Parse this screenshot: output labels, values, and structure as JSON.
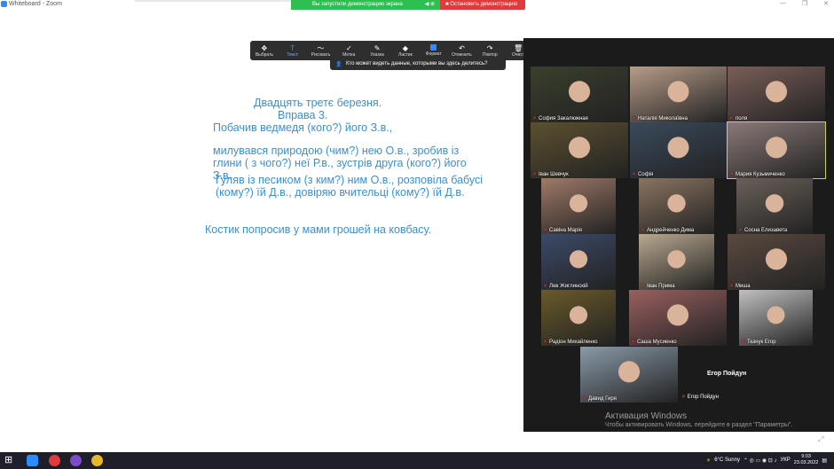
{
  "window": {
    "title": "Whiteboard - Zoom"
  },
  "share_banner": {
    "status": "Вы запустили демонстрацию экрана",
    "stop_label": "Остановить демонстрацию"
  },
  "toolbar": {
    "tools": [
      {
        "icon": "move-icon",
        "label": "Выбрать"
      },
      {
        "icon": "text-icon",
        "label": "Текст",
        "active": true
      },
      {
        "icon": "draw-icon",
        "label": "Рисовать"
      },
      {
        "icon": "stamp-icon",
        "label": "Метка"
      },
      {
        "icon": "spotlight-icon",
        "label": "Указка"
      },
      {
        "icon": "eraser-icon",
        "label": "Ластик"
      },
      {
        "icon": "format-icon",
        "label": "Формат"
      },
      {
        "icon": "undo-icon",
        "label": "Отменить"
      },
      {
        "icon": "redo-icon",
        "label": "Повтор"
      },
      {
        "icon": "clear-icon",
        "label": "Очист"
      }
    ],
    "privacy_prompt": "Кто может видеть данные, которыми вы здесь делитесь?"
  },
  "whiteboard": {
    "lines": [
      "Двадцять третє березня.",
      "Вправа 3.",
      "Побачив ведмедя (кого?) його З.в.,",
      "милувався природою (чим?)  нею  О.в., зробив із",
      "глини ( з чого?)  неї  Р.в.,  зустрів друга  (кого?) його",
      "З.в.",
      "Гуляв із песиком  (з ким?) ним О.в., розповіла бабусі",
      "(кому?) їй  Д.в., довіряю вчительці (кому?) їй Д.в.",
      "Костик попросив у мами грошей на ковбасу."
    ]
  },
  "participants": [
    {
      "name": "София Закалюжная",
      "color": "#3a3f2c"
    },
    {
      "name": "Наталія Миколаївна",
      "color": "#b79c88"
    },
    {
      "name": "поля",
      "color": "#7a5e58"
    },
    {
      "name": "Іван Шевчук",
      "color": "#5c5030"
    },
    {
      "name": "Софія",
      "color": "#3a4a5c"
    },
    {
      "name": "Мария Кузьмиченко",
      "color": "#8a7a78"
    },
    {
      "name": "Савіна Марія",
      "color": "#a07a68"
    },
    {
      "name": "Андрейченко Дима",
      "color": "#8a7460"
    },
    {
      "name": "Сосна Елизавета",
      "color": "#6a6058"
    },
    {
      "name": "Лев Жиглинскій",
      "color": "#3c4a68"
    },
    {
      "name": "Іван Прима",
      "color": "#b8a890"
    },
    {
      "name": "Миша",
      "color": "#5a4a40"
    },
    {
      "name": "Радіон Михайленко",
      "color": "#6a5a2a"
    },
    {
      "name": "Саша Мусиенко",
      "color": "#9a6060"
    },
    {
      "name": "Ткачук Егор",
      "color": "#c0c0c0"
    },
    {
      "name": "Давид Гиря",
      "color": "#8a9aa8"
    }
  ],
  "active_speaker": {
    "name": "Егор Пойдун"
  },
  "windows_activation": {
    "title": "Активация Windows",
    "subtitle": "Чтобы активировать Windows, перейдите в раздел \"Параметры\"."
  },
  "taskbar": {
    "weather": "6°C  Sunny",
    "lang": "УКР",
    "time": "9:03",
    "date": "23.03.2022"
  }
}
